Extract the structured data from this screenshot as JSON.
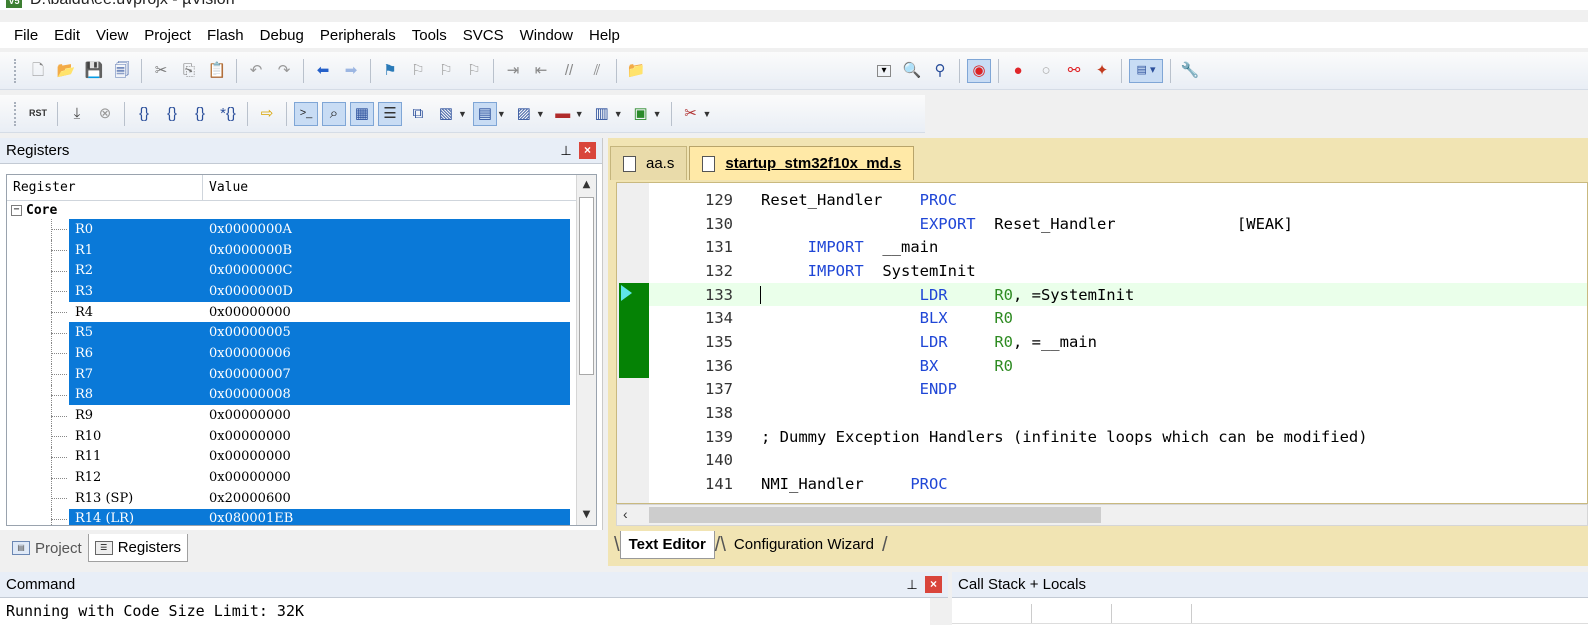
{
  "window": {
    "title": "D:\\baidu\\ee.uvprojx - µVision"
  },
  "menu": [
    "File",
    "Edit",
    "View",
    "Project",
    "Flash",
    "Debug",
    "Peripherals",
    "Tools",
    "SVCS",
    "Window",
    "Help"
  ],
  "registers": {
    "title": "Registers",
    "col_register": "Register",
    "col_value": "Value",
    "group": "Core",
    "rows": [
      {
        "name": "R0",
        "value": "0x0000000A",
        "selected": true
      },
      {
        "name": "R1",
        "value": "0x0000000B",
        "selected": true
      },
      {
        "name": "R2",
        "value": "0x0000000C",
        "selected": true
      },
      {
        "name": "R3",
        "value": "0x0000000D",
        "selected": true
      },
      {
        "name": "R4",
        "value": "0x00000000",
        "selected": false
      },
      {
        "name": "R5",
        "value": "0x00000005",
        "selected": true
      },
      {
        "name": "R6",
        "value": "0x00000006",
        "selected": true
      },
      {
        "name": "R7",
        "value": "0x00000007",
        "selected": true
      },
      {
        "name": "R8",
        "value": "0x00000008",
        "selected": true
      },
      {
        "name": "R9",
        "value": "0x00000000",
        "selected": false
      },
      {
        "name": "R10",
        "value": "0x00000000",
        "selected": false
      },
      {
        "name": "R11",
        "value": "0x00000000",
        "selected": false
      },
      {
        "name": "R12",
        "value": "0x00000000",
        "selected": false
      },
      {
        "name": "R13 (SP)",
        "value": "0x20000600",
        "selected": false
      },
      {
        "name": "R14 (LR)",
        "value": "0x080001EB",
        "selected": true
      }
    ]
  },
  "left_tabs": {
    "project": "Project",
    "registers": "Registers"
  },
  "editor": {
    "tabs": [
      {
        "label": "aa.s",
        "active": false
      },
      {
        "label": "startup_stm32f10x_md.s",
        "active": true
      }
    ],
    "lines": [
      {
        "num": "129",
        "parts": [
          [
            "t",
            "Reset_Handler    "
          ],
          [
            "k",
            "PROC"
          ]
        ]
      },
      {
        "num": "130",
        "parts": [
          [
            "t",
            "                 "
          ],
          [
            "k",
            "EXPORT"
          ],
          [
            "t",
            "  Reset_Handler             [WEAK]"
          ]
        ]
      },
      {
        "num": "131",
        "parts": [
          [
            "t",
            "     "
          ],
          [
            "k",
            "IMPORT"
          ],
          [
            "t",
            "  __main"
          ]
        ]
      },
      {
        "num": "132",
        "parts": [
          [
            "t",
            "     "
          ],
          [
            "k",
            "IMPORT"
          ],
          [
            "t",
            "  SystemInit"
          ]
        ]
      },
      {
        "num": "133",
        "current": true,
        "parts": [
          [
            "t",
            "                 "
          ],
          [
            "k",
            "LDR"
          ],
          [
            "t",
            "     "
          ],
          [
            "r",
            "R0"
          ],
          [
            "t",
            ", =SystemInit"
          ]
        ]
      },
      {
        "num": "134",
        "parts": [
          [
            "t",
            "                 "
          ],
          [
            "k",
            "BLX"
          ],
          [
            "t",
            "     "
          ],
          [
            "r",
            "R0"
          ]
        ]
      },
      {
        "num": "135",
        "parts": [
          [
            "t",
            "                 "
          ],
          [
            "k",
            "LDR"
          ],
          [
            "t",
            "     "
          ],
          [
            "r",
            "R0"
          ],
          [
            "t",
            ", =__main"
          ]
        ]
      },
      {
        "num": "136",
        "parts": [
          [
            "t",
            "                 "
          ],
          [
            "k",
            "BX"
          ],
          [
            "t",
            "      "
          ],
          [
            "r",
            "R0"
          ]
        ]
      },
      {
        "num": "137",
        "parts": [
          [
            "t",
            "                 "
          ],
          [
            "k",
            "ENDP"
          ]
        ]
      },
      {
        "num": "138",
        "parts": []
      },
      {
        "num": "139",
        "parts": [
          [
            "t",
            "; Dummy Exception Handlers (infinite loops which can be modified)"
          ]
        ]
      },
      {
        "num": "140",
        "parts": []
      },
      {
        "num": "141",
        "parts": [
          [
            "t",
            "NMI_Handler     "
          ],
          [
            "k",
            "PROC"
          ]
        ]
      }
    ],
    "bottom_tabs": {
      "text_editor": "Text Editor",
      "config_wizard": "Configuration Wizard"
    }
  },
  "command": {
    "title": "Command",
    "text": "Running with Code Size Limit: 32K"
  },
  "callstack": {
    "title": "Call Stack + Locals"
  },
  "colors": {
    "selection": "#0a79d8",
    "keyword": "#1f46d6",
    "register": "#2e8b22",
    "current_line": "#eaffea",
    "gutter_marker": "#058205"
  }
}
